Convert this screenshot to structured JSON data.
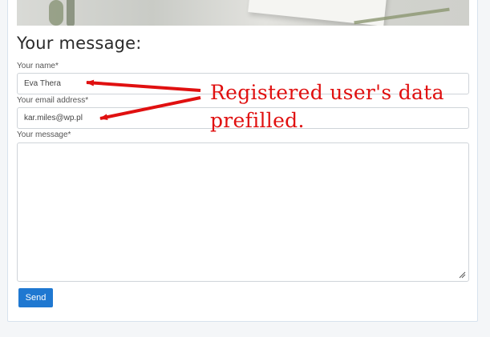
{
  "form": {
    "title": "Your message:",
    "name_label": "Your name*",
    "name_value": "Eva Thera",
    "email_label": "Your email address*",
    "email_value": "kar.miles@wp.pl",
    "message_label": "Your message*",
    "message_value": "",
    "send_label": "Send"
  },
  "annotation": {
    "line1": "Registered user's data",
    "line2": "prefilled."
  },
  "colors": {
    "annotation": "#e01010",
    "send_button": "#1f78d1"
  }
}
